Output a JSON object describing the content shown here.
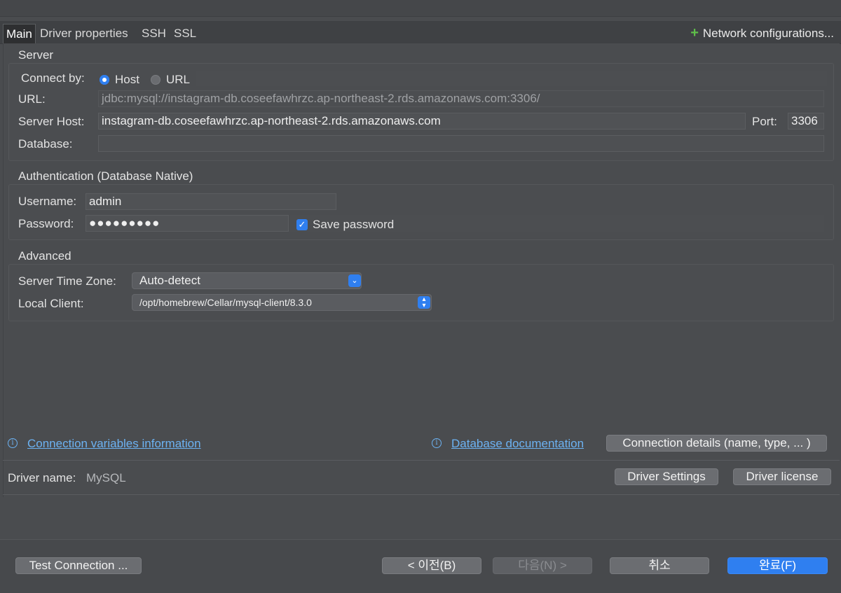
{
  "tabs": [
    "Main",
    "Driver properties",
    "SSH",
    "SSL"
  ],
  "network_config_label": "Network configurations...",
  "server": {
    "title": "Server",
    "connect_by_label": "Connect by:",
    "option_host": "Host",
    "option_url": "URL",
    "url_label": "URL:",
    "url_value": "jdbc:mysql://instagram-db.coseefawhrzc.ap-northeast-2.rds.amazonaws.com:3306/",
    "host_label": "Server Host:",
    "host_value": "instagram-db.coseefawhrzc.ap-northeast-2.rds.amazonaws.com",
    "port_label": "Port:",
    "port_value": "3306",
    "database_label": "Database:",
    "database_value": ""
  },
  "auth": {
    "title": "Authentication (Database Native)",
    "username_label": "Username:",
    "username_value": "admin",
    "password_label": "Password:",
    "password_value": "●●●●●●●●●",
    "save_password_label": "Save password"
  },
  "advanced": {
    "title": "Advanced",
    "timezone_label": "Server Time Zone:",
    "timezone_value": "Auto-detect",
    "local_client_label": "Local Client:",
    "local_client_value": "/opt/homebrew/Cellar/mysql-client/8.3.0"
  },
  "links": {
    "connection_variables": "Connection variables information",
    "database_documentation": "Database documentation",
    "connection_details_button": "Connection details (name, type, ... )"
  },
  "driver": {
    "name_label": "Driver name:",
    "name_value": "MySQL",
    "settings_button": "Driver Settings",
    "license_button": "Driver license"
  },
  "footer": {
    "test_connection": "Test Connection ...",
    "prev": "< 이전(B)",
    "next": "다음(N) >",
    "cancel": "취소",
    "finish": "완료(F)"
  }
}
